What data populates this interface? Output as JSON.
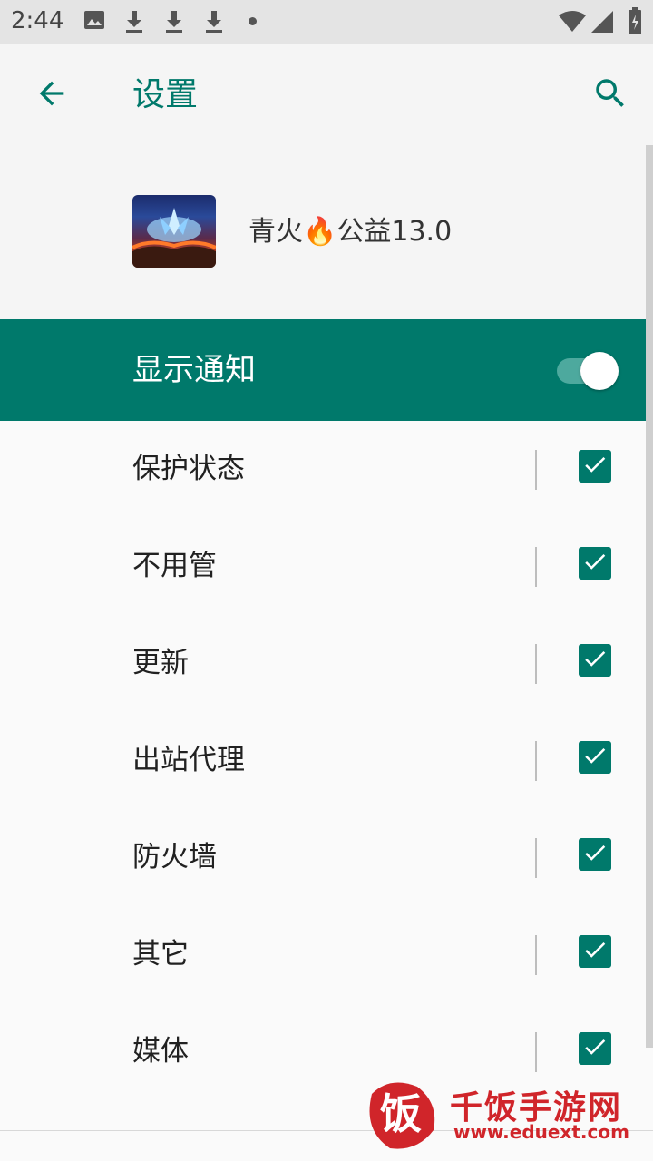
{
  "status_bar": {
    "time": "2:44",
    "icons": [
      "image-icon",
      "download-icon",
      "download-icon",
      "download-icon",
      "dot-icon",
      "wifi-icon",
      "signal-icon",
      "battery-icon"
    ]
  },
  "app_bar": {
    "title": "设置",
    "back_icon": "arrow-back-icon",
    "search_icon": "search-icon"
  },
  "app_header": {
    "name_prefix": "青火",
    "name_emoji": "🔥",
    "name_suffix": "公益13.0"
  },
  "main_switch": {
    "label": "显示通知",
    "checked": true
  },
  "channels": [
    {
      "label": "保护状态",
      "checked": true
    },
    {
      "label": "不用管",
      "checked": true
    },
    {
      "label": "更新",
      "checked": true
    },
    {
      "label": "出站代理",
      "checked": true
    },
    {
      "label": "防火墙",
      "checked": true
    },
    {
      "label": "其它",
      "checked": true
    },
    {
      "label": "媒体",
      "checked": true
    }
  ],
  "watermark": {
    "logo_char": "饭",
    "title": "千饭手游网",
    "url": "www.eduext.com"
  },
  "colors": {
    "accent": "#00796b",
    "toggle_track": "#4da99e",
    "watermark_red": "#d0252a"
  }
}
